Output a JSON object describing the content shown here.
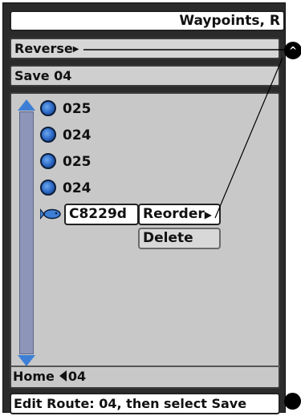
{
  "title_bar": {
    "text": "Waypoints, R"
  },
  "options": {
    "reverse_label": "Reverse",
    "save_label": "Save 04"
  },
  "waypoints": [
    {
      "name": "025"
    },
    {
      "name": "024"
    },
    {
      "name": "025"
    },
    {
      "name": "024"
    }
  ],
  "selected_waypoint": {
    "name": "C8229d"
  },
  "context_menu": {
    "reorder_label": "Reorder",
    "delete_label": "Delete"
  },
  "footer": {
    "home_label": "Home",
    "route_value": "04"
  },
  "status": {
    "text": "Edit Route: 04, then select Save"
  },
  "callout": {
    "marker_label": "^"
  },
  "colors": {
    "accent_blue": "#3e7fd6",
    "scroll_track": "#8d96b8",
    "panel_gray": "#c8c8c8"
  },
  "icons": {
    "waypoint": "waypoint-circle-icon",
    "fish": "fish-icon",
    "scroll_up": "scroll-up-arrow-icon",
    "scroll_down": "scroll-down-arrow-icon",
    "left_arrow": "left-arrow-icon"
  }
}
